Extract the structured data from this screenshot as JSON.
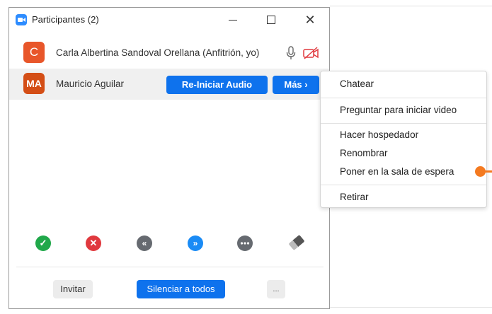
{
  "window": {
    "title": "Participantes (2)",
    "minimize": "",
    "maximize": "",
    "close": "✕"
  },
  "participants": [
    {
      "initials": "C",
      "name": "Carla Albertina Sandoval Orellana (Anfitrión, yo)",
      "avatar_color": "#e8562a"
    },
    {
      "initials": "MA",
      "name": "Mauricio Aguilar",
      "avatar_color": "#d44e16"
    }
  ],
  "row_actions": {
    "reiniciar_audio": "Re-Iniciar Audio",
    "mas": "Más ›"
  },
  "reactions": [
    {
      "icon": "check-icon",
      "glyph": "✓"
    },
    {
      "icon": "x-icon",
      "glyph": "✕"
    },
    {
      "icon": "go-slower-icon",
      "glyph": "«"
    },
    {
      "icon": "go-faster-icon",
      "glyph": "»"
    },
    {
      "icon": "more-icon",
      "glyph": "•••"
    },
    {
      "icon": "clear-all-icon",
      "glyph": ""
    }
  ],
  "footer": {
    "invitar": "Invitar",
    "silenciar": "Silenciar a todos",
    "more": "..."
  },
  "context_menu": {
    "items": [
      "Chatear",
      "Preguntar para iniciar video",
      "Hacer hospedador",
      "Renombrar",
      "Poner en la sala de espera",
      "Retirar"
    ]
  },
  "colors": {
    "accent": "#0e72ed",
    "pointer": "#f47a20"
  }
}
